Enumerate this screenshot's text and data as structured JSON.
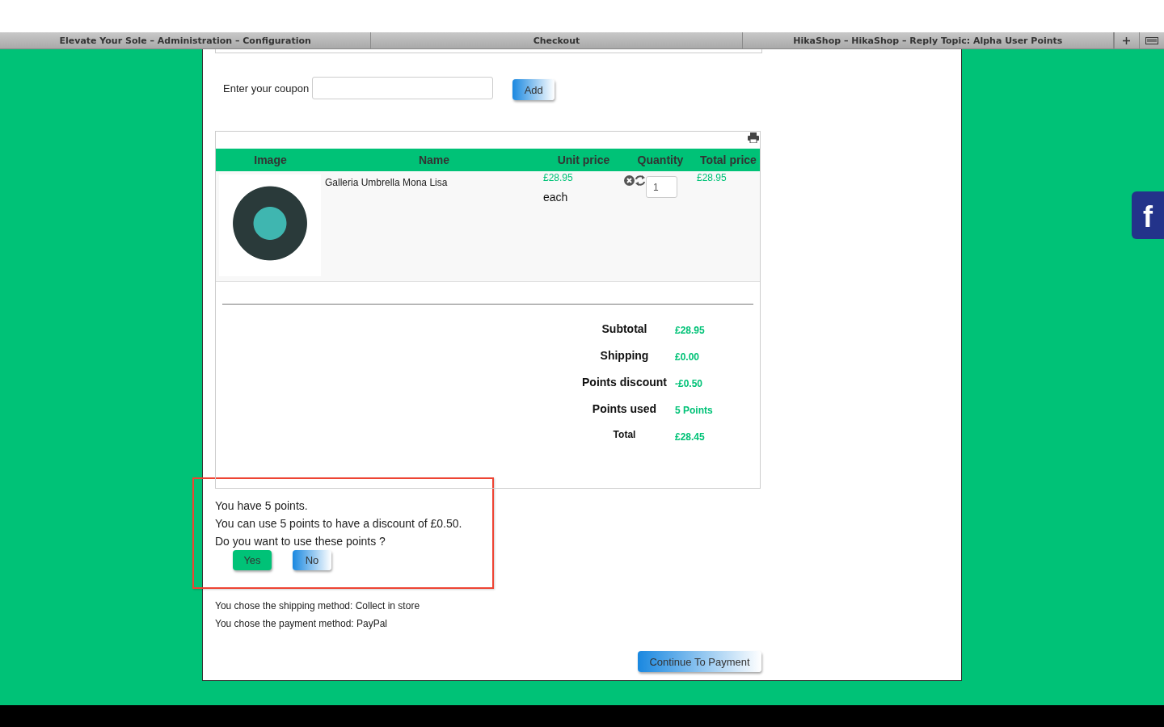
{
  "browser_tabs": [
    {
      "title": "Elevate Your Sole – Administration – Configuration"
    },
    {
      "title": "Checkout"
    },
    {
      "title": "HikaShop – HikaShop – Reply Topic: Alpha User Points"
    }
  ],
  "coupon": {
    "label": "Enter your coupon",
    "button": "Add"
  },
  "cart": {
    "columns": [
      "Image",
      "Name",
      "Unit price",
      "Quantity",
      "Total price"
    ],
    "rows": [
      {
        "name": "Galleria Umbrella Mona Lisa",
        "unit_price": "£28.95",
        "unit_note": "each",
        "quantity": "1",
        "total_price": "£28.95"
      }
    ],
    "totals": [
      {
        "label": "Subtotal",
        "value": "£28.95"
      },
      {
        "label": "Shipping",
        "value": "£0.00"
      },
      {
        "label": "Points discount",
        "value": "-£0.50"
      },
      {
        "label": "Points used",
        "value": "5 Points"
      },
      {
        "label": "Total",
        "value": "£28.45"
      }
    ]
  },
  "points": {
    "lines": [
      "You have 5 points.",
      "You can use 5 points to have a discount of £0.50.",
      "Do you want to use these points ?"
    ],
    "yes": "Yes",
    "no": "No"
  },
  "methods": [
    "You chose the shipping method: Collect in store",
    "You chose the payment method: PayPal"
  ],
  "continue_button": "Continue To Payment",
  "facebook_button": {
    "label": "f"
  }
}
